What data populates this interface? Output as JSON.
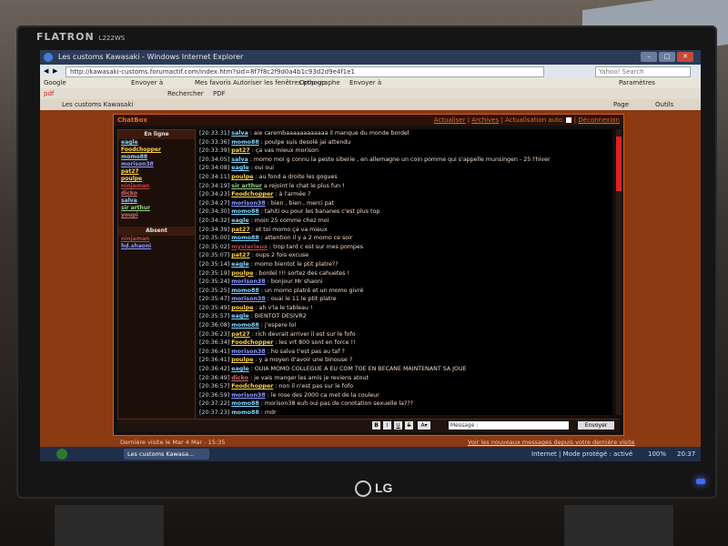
{
  "monitor": {
    "brand": "FLATRON",
    "model": "L222WS",
    "maker": "LG"
  },
  "browser": {
    "window_title": "Les customs Kawasaki - Windows Internet Explorer",
    "url": "http://kawasaki-customs.forumactif.com/index.htm?sid=8f7f8c2f9d0a4b1c93d2d9e4f1e1",
    "search_placeholder": "Yahoo! Search",
    "toolbar_items": [
      "Google",
      "Envoyer à",
      "Mes favoris",
      "Autoriser les fenêtres pop-up",
      "Orthographe",
      "Envoyer à"
    ],
    "toolbar2_items": [
      "pdf",
      "Rechercher",
      "PDF"
    ],
    "tab_label": "Les customs Kawasaki",
    "right_controls": [
      "Paramètres",
      "Page",
      "Outils"
    ]
  },
  "chatbox": {
    "title": "ChatBox",
    "header_links": [
      "Actualiser",
      "Archives",
      "Actualisation auto.",
      "Déconnexion"
    ],
    "online_label": "En ligne",
    "absent_label": "Absent",
    "online_users": [
      {
        "name": "eagle",
        "color": "#7fd7ff"
      },
      {
        "name": "Foodchopper",
        "color": "#ffd34d"
      },
      {
        "name": "momo88",
        "color": "#7fd7ff"
      },
      {
        "name": "morison38",
        "color": "#8f9bff"
      },
      {
        "name": "pat27",
        "color": "#ffd34d"
      },
      {
        "name": "poulpe",
        "color": "#ffd34d"
      },
      {
        "name": "ninjaman",
        "color": "#c0453c"
      },
      {
        "name": "dicko",
        "color": "#d06e6e"
      },
      {
        "name": "salva",
        "color": "#7fd7ff"
      },
      {
        "name": "sir arthur",
        "color": "#8fd17f"
      },
      {
        "name": "youpi",
        "color": "#d06e6e"
      }
    ],
    "absent_users": [
      {
        "name": "ninjaman",
        "color": "#c0453c"
      },
      {
        "name": "hd.shaoni",
        "color": "#8f9bff"
      }
    ],
    "messages": [
      {
        "time": "[20:33:31]",
        "user": "salva",
        "ucolor": "#7fd7ff",
        "text": " : aie carembaaaaaaaaaaaa il manque du monde bordel"
      },
      {
        "time": "[20:33:36]",
        "user": "momo88",
        "ucolor": "#7fd7ff",
        "text": " : poulpe suis desolé jai attendu"
      },
      {
        "time": "[20:33:39]",
        "user": "pat27",
        "ucolor": "#ffd34d",
        "text": " : ça vas mieux morison"
      },
      {
        "time": "[20:34:05]",
        "user": "salva",
        "ucolor": "#7fd7ff",
        "text": " : momo moi g connu la peste siberie , en allemagne un coin pomme qui s'appelle munsingen - 25 l'hiver"
      },
      {
        "time": "[20:34:08]",
        "user": "eagle",
        "ucolor": "#7fd7ff",
        "text": " : oui oui"
      },
      {
        "time": "[20:34:11]",
        "user": "poulpe",
        "ucolor": "#ffd34d",
        "text": " : au fond a droite les gogues"
      },
      {
        "time": "[20:34:19]",
        "user": "sir arthur",
        "ucolor": "#8fd17f",
        "text": " a rejoint le chat le plus fun !"
      },
      {
        "time": "[20:34:23]",
        "user": "Foodchopper",
        "ucolor": "#ffd34d",
        "text": " : à l'armée ?"
      },
      {
        "time": "[20:34:27]",
        "user": "morison38",
        "ucolor": "#8f9bff",
        "text": " : bien , bien , merci pat"
      },
      {
        "time": "[20:34:30]",
        "user": "momo88",
        "ucolor": "#7fd7ff",
        "text": " : tahiti ou pour les bananes c'est plus top"
      },
      {
        "time": "[20:34:32]",
        "user": "eagle",
        "ucolor": "#7fd7ff",
        "text": " : moin 25 comme chez moi"
      },
      {
        "time": "[20:34:39]",
        "user": "pat27",
        "ucolor": "#ffd34d",
        "text": " : et toi momo ça va mieux"
      },
      {
        "time": "[20:35:00]",
        "user": "momo88",
        "ucolor": "#7fd7ff",
        "text": " : attention il y a 2 momo ce soir"
      },
      {
        "time": "[20:35:02]",
        "user": "mysterieux",
        "ucolor": "#c0453c",
        "text": " : trop tard c est sur mes pompes"
      },
      {
        "time": "[20:35:07]",
        "user": "pat27",
        "ucolor": "#ffd34d",
        "text": " : oups 2 fois excuse"
      },
      {
        "time": "[20:35:14]",
        "user": "eagle",
        "ucolor": "#7fd7ff",
        "text": " : momo bientot le ptit platre??"
      },
      {
        "time": "[20:35:19]",
        "user": "poulpe",
        "ucolor": "#ffd34d",
        "text": " : bordel !!! sortez des cahuetes !"
      },
      {
        "time": "[20:35:24]",
        "user": "morison38",
        "ucolor": "#8f9bff",
        "text": " : bonjour Mr shaoni"
      },
      {
        "time": "[20:35:25]",
        "user": "momo88",
        "ucolor": "#7fd7ff",
        "text": " : un momo platré et un momo givré"
      },
      {
        "time": "[20:35:47]",
        "user": "morison38",
        "ucolor": "#8f9bff",
        "text": " : ouai le 11 le ptit platre"
      },
      {
        "time": "[20:35:49]",
        "user": "poulpe",
        "ucolor": "#ffd34d",
        "text": " : ah v'la le tableau !"
      },
      {
        "time": "[20:35:57]",
        "user": "eagle",
        "ucolor": "#7fd7ff",
        "text": " : BIENTOT DESIVR2"
      },
      {
        "time": "[20:36:08]",
        "user": "momo88",
        "ucolor": "#7fd7ff",
        "text": " : j'espere lol"
      },
      {
        "time": "[20:36:23]",
        "user": "pat27",
        "ucolor": "#ffd34d",
        "text": " : rich devrait arriver il est sur le fofo"
      },
      {
        "time": "[20:36:34]",
        "user": "Foodchopper",
        "ucolor": "#ffd34d",
        "text": " : les vrt 800 sont en force !!"
      },
      {
        "time": "[20:36:41]",
        "user": "morison38",
        "ucolor": "#8f9bff",
        "text": " : ho salva t'est pas au taf ?"
      },
      {
        "time": "[20:36:41]",
        "user": "poulpe",
        "ucolor": "#ffd34d",
        "text": " : y a moyen d'avoir une binouse ?"
      },
      {
        "time": "[20:36:42]",
        "user": "eagle",
        "ucolor": "#7fd7ff",
        "text": " : OUIA MOMO COLLEGUE A EU COM TOE EN BECANE MAINTENANT SA JOUE"
      },
      {
        "time": "[20:36:49]",
        "user": "dicko",
        "ucolor": "#d06e6e",
        "text": " : je vais manger les amis je reviens atout"
      },
      {
        "time": "[20:36:57]",
        "user": "Foodchopper",
        "ucolor": "#ffd34d",
        "text": " : non il n'est pas sur le fofo"
      },
      {
        "time": "[20:36:59]",
        "user": "morison38",
        "ucolor": "#8f9bff",
        "text": " : le rose des 2000 ca met de la couleur"
      },
      {
        "time": "[20:37:22]",
        "user": "momo88",
        "ucolor": "#7fd7ff",
        "text": " : morison38 euh oui pas de conotation sexuelle la???"
      },
      {
        "time": "[20:37:23]",
        "user": "momo88",
        "ucolor": "#7fd7ff",
        "text": " : mdr"
      }
    ],
    "input": {
      "message_label": "Message :",
      "send_label": "Envoyer",
      "format_buttons": [
        "B",
        "I",
        "U",
        "S"
      ]
    }
  },
  "footer": {
    "last_visit": "Dernière visite le Mar 4 Mar - 15:35",
    "new_messages": "Voir les nouveaux messages depuis votre dernière visite"
  },
  "statusbar": {
    "zone": "Internet | Mode protégé : activé",
    "zoom": "100%",
    "task_label": "Les customs Kawasa...",
    "clock": "20:37"
  }
}
